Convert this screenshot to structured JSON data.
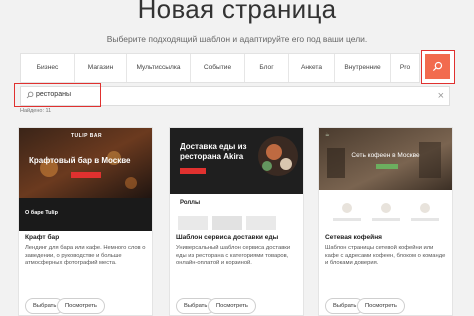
{
  "page": {
    "title": "Новая страница",
    "subtitle": "Выберите подходящий шаблон и адаптируйте его под ваши цели."
  },
  "filters": [
    "Бизнес",
    "Магазин",
    "Мультиссылка",
    "Событие",
    "Блог",
    "Анкета",
    "Внутренние",
    "Pro"
  ],
  "search": {
    "value": "рестораны",
    "icon": "search-icon",
    "clear_icon": "close-icon"
  },
  "results": {
    "found_label": "Найдено: 11"
  },
  "colors": {
    "accent": "#f26b4e",
    "highlight": "#e0312f"
  },
  "cards": [
    {
      "title": "Крафт бар",
      "description": "Лендинг для бара или кафе. Немного слов о заведении, о руководстве и больше атмосферных фотографий места.",
      "choose_label": "Выбрать",
      "view_label": "Посмотреть",
      "thumb": {
        "brand": "TULIP BAR",
        "headline": "Крафтовый бар в Москве",
        "about": "О баре Tulip"
      }
    },
    {
      "title": "Шаблон сервиса доставки еды",
      "description": "Универсальный шаблон сервиса доставки еды из ресторана с категориями товаров, онлайн-оплатой и корзиной.",
      "choose_label": "Выбрать",
      "view_label": "Посмотреть",
      "thumb": {
        "headline": "Доставка еды из ресторана Akira",
        "section": "Роллы"
      }
    },
    {
      "title": "Сетевая кофейня",
      "description": "Шаблон страницы сетевой кофейни или кафе с адресами кофеен, блоком о команде и блоками доверия.",
      "choose_label": "Выбрать",
      "view_label": "Посмотреть",
      "thumb": {
        "headline": "Сеть кофеен в Москве"
      }
    }
  ]
}
